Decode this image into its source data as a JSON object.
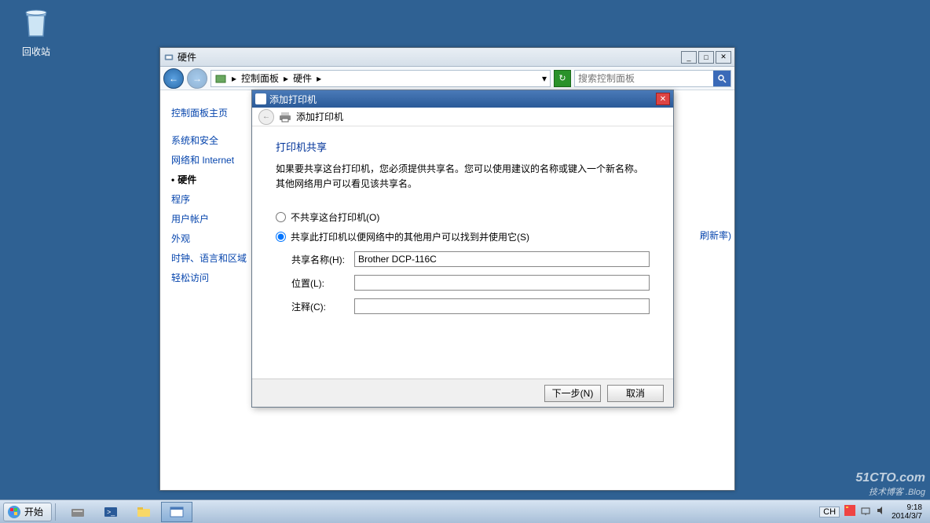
{
  "desktop": {
    "recycle_bin": "回收站"
  },
  "cp_window": {
    "title": "硬件",
    "breadcrumb": {
      "root": "控制面板",
      "current": "硬件"
    },
    "search_placeholder": "搜索控制面板",
    "sidebar": {
      "items": [
        {
          "label": "控制面板主页"
        },
        {
          "label": "系统和安全"
        },
        {
          "label": "网络和 Internet"
        },
        {
          "label": "硬件",
          "active": true
        },
        {
          "label": "程序"
        },
        {
          "label": "用户帐户"
        },
        {
          "label": "外观"
        },
        {
          "label": "时钟、语言和区域"
        },
        {
          "label": "轻松访问"
        }
      ]
    },
    "right_label": "刷新率)"
  },
  "dialog": {
    "title": "添加打印机",
    "header": "添加打印机",
    "section_title": "打印机共享",
    "description": "如果要共享这台打印机，您必须提供共享名。您可以使用建议的名称或键入一个新名称。其他网络用户可以看见该共享名。",
    "radio_no_share": "不共享这台打印机(O)",
    "radio_share": "共享此打印机以便网络中的其他用户可以找到并使用它(S)",
    "label_share_name": "共享名称(H):",
    "value_share_name": "Brother DCP-116C",
    "label_location": "位置(L):",
    "value_location": "",
    "label_comment": "注释(C):",
    "value_comment": "",
    "btn_next": "下一步(N)",
    "btn_cancel": "取消"
  },
  "taskbar": {
    "start": "开始",
    "lang": "CH",
    "time": "9:18",
    "date": "2014/3/7"
  },
  "watermark": {
    "main": "51CTO.com",
    "sub": "技术博客 .Blog"
  }
}
